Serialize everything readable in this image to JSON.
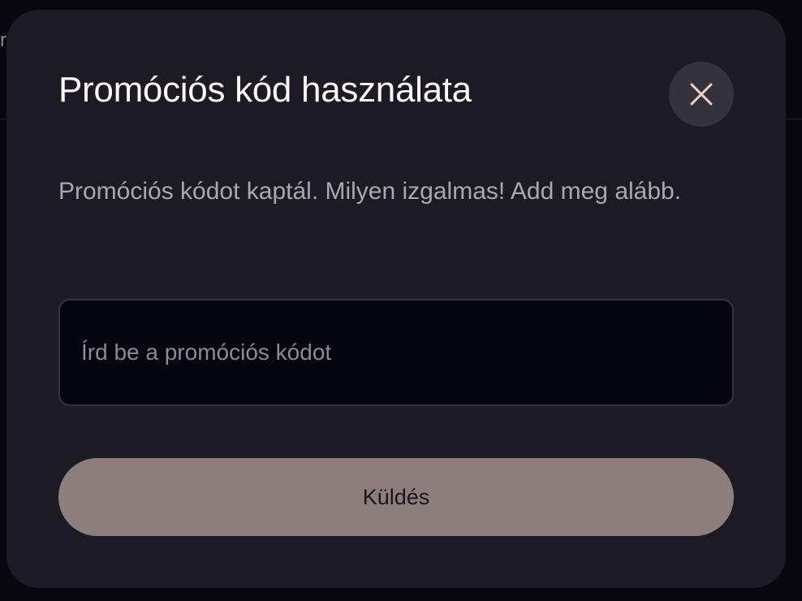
{
  "modal": {
    "title": "Promóciós kód használata",
    "description": "Promóciós kódot kaptál. Milyen izgalmas! Add meg alább.",
    "input": {
      "placeholder": "Írd be a promóciós kódot",
      "value": ""
    },
    "submit_label": "Küldés",
    "close_icon": "close-icon"
  },
  "background": {
    "partial_text": "r"
  },
  "colors": {
    "page_background": "#07070d",
    "modal_background": "#1c1b24",
    "close_button_background": "#34333b",
    "close_icon": "#f2cfc2",
    "input_background": "#05050f",
    "submit_button_background": "#8d7e7d",
    "title_text": "#fdf6f3",
    "description_text": "#aaa7ad"
  }
}
